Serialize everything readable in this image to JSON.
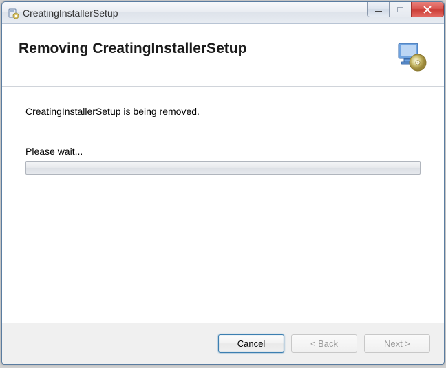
{
  "window": {
    "title": "CreatingInstallerSetup"
  },
  "header": {
    "title": "Removing CreatingInstallerSetup"
  },
  "content": {
    "status": "CreatingInstallerSetup is being removed.",
    "wait_label": "Please wait..."
  },
  "footer": {
    "cancel": "Cancel",
    "back": "< Back",
    "next": "Next >"
  }
}
